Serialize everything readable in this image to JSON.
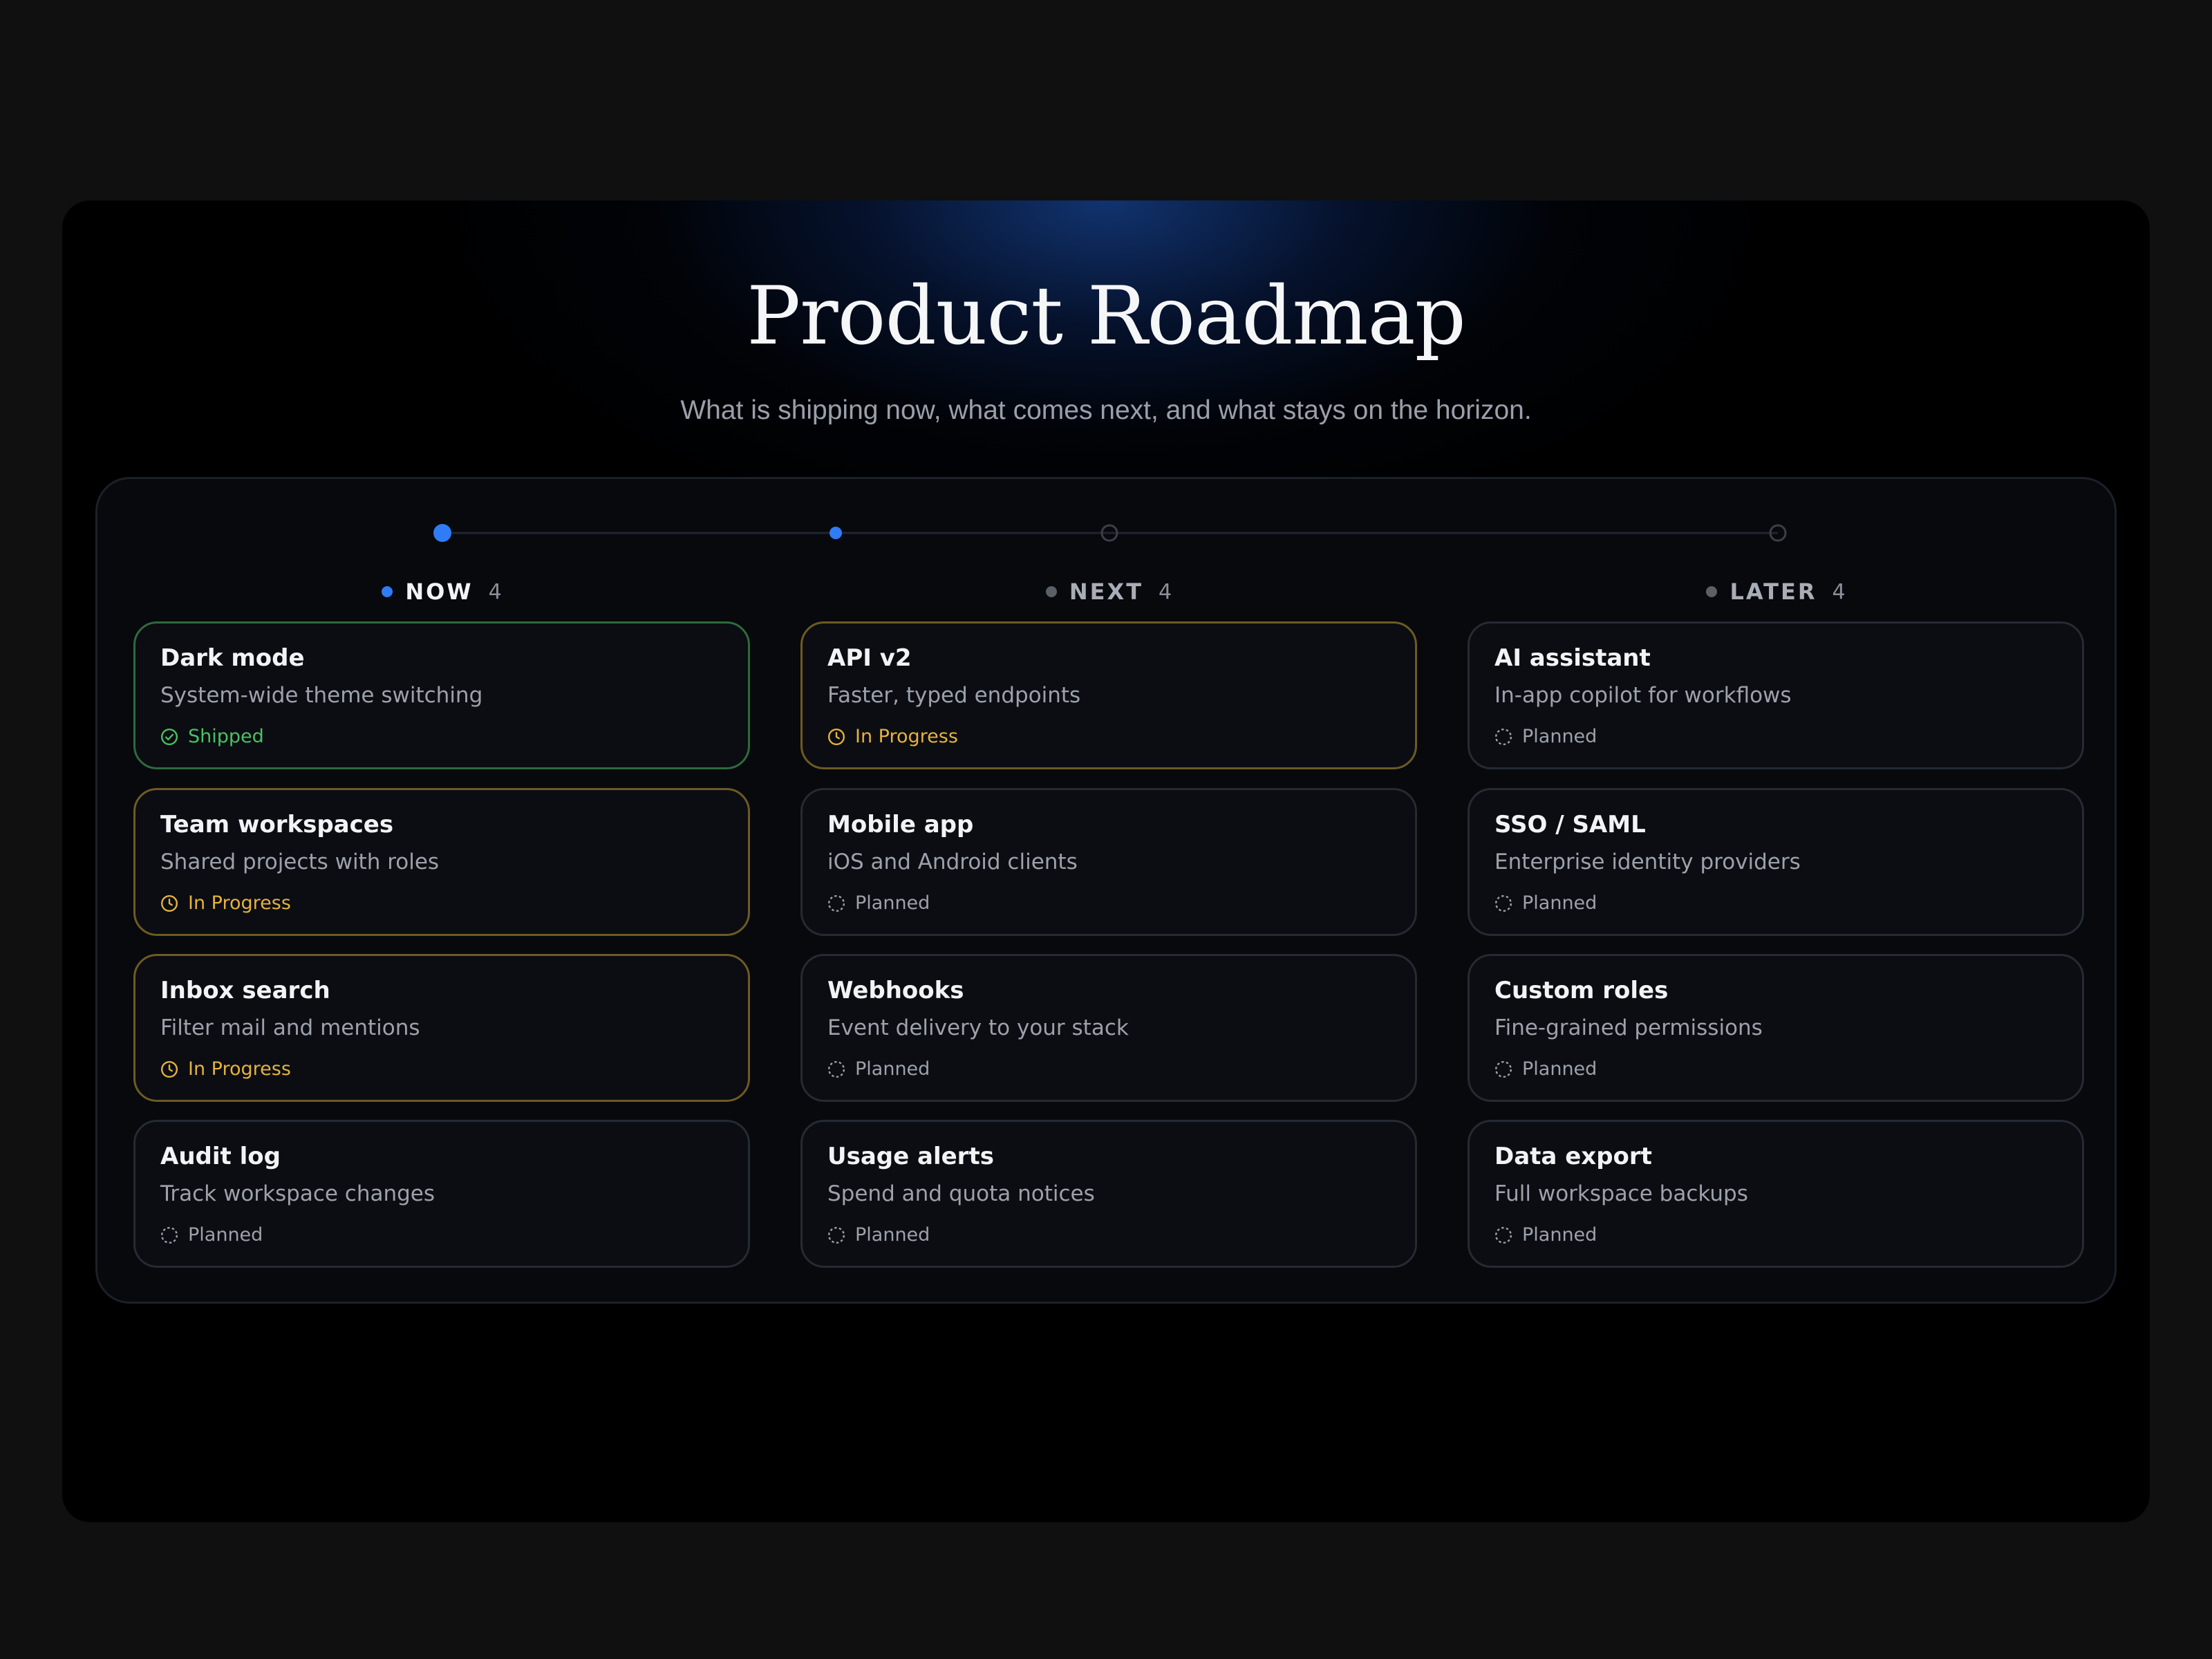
{
  "header": {
    "title": "Product Roadmap",
    "subtitle": "What is shipping now, what comes next, and what stays on the horizon."
  },
  "colors": {
    "accent": "#2f7cf6",
    "shipped": "#4cc063",
    "in_progress": "#e5b23c",
    "planned": "#9ca1ab",
    "inactive_dot": "#5a5f68"
  },
  "columns": [
    {
      "label": "NOW",
      "count": "4",
      "active": true,
      "cards": [
        {
          "title": "Dark mode",
          "desc": "System-wide theme switching",
          "status": "Shipped",
          "kind": "shipped",
          "icon": "check-circle-icon"
        },
        {
          "title": "Team workspaces",
          "desc": "Shared projects with roles",
          "status": "In Progress",
          "kind": "progress",
          "icon": "clock-icon"
        },
        {
          "title": "Inbox search",
          "desc": "Filter mail and mentions",
          "status": "In Progress",
          "kind": "progress",
          "icon": "clock-icon"
        },
        {
          "title": "Audit log",
          "desc": "Track workspace changes",
          "status": "Planned",
          "kind": "planned",
          "icon": "dashed-circle-icon"
        }
      ]
    },
    {
      "label": "NEXT",
      "count": "4",
      "active": false,
      "cards": [
        {
          "title": "API v2",
          "desc": "Faster, typed endpoints",
          "status": "In Progress",
          "kind": "progress",
          "icon": "clock-icon"
        },
        {
          "title": "Mobile app",
          "desc": "iOS and Android clients",
          "status": "Planned",
          "kind": "planned",
          "icon": "dashed-circle-icon"
        },
        {
          "title": "Webhooks",
          "desc": "Event delivery to your stack",
          "status": "Planned",
          "kind": "planned",
          "icon": "dashed-circle-icon"
        },
        {
          "title": "Usage alerts",
          "desc": "Spend and quota notices",
          "status": "Planned",
          "kind": "planned",
          "icon": "dashed-circle-icon"
        }
      ]
    },
    {
      "label": "LATER",
      "count": "4",
      "active": false,
      "cards": [
        {
          "title": "AI assistant",
          "desc": "In-app copilot for workflows",
          "status": "Planned",
          "kind": "planned",
          "icon": "dashed-circle-icon"
        },
        {
          "title": "SSO / SAML",
          "desc": "Enterprise identity providers",
          "status": "Planned",
          "kind": "planned",
          "icon": "dashed-circle-icon"
        },
        {
          "title": "Custom roles",
          "desc": "Fine-grained permissions",
          "status": "Planned",
          "kind": "planned",
          "icon": "dashed-circle-icon"
        },
        {
          "title": "Data export",
          "desc": "Full workspace backups",
          "status": "Planned",
          "kind": "planned",
          "icon": "dashed-circle-icon"
        }
      ]
    }
  ],
  "timeline": {
    "nodes": [
      {
        "state": "current"
      },
      {
        "state": "done"
      },
      {
        "state": "upcoming"
      },
      {
        "state": "upcoming"
      }
    ]
  }
}
